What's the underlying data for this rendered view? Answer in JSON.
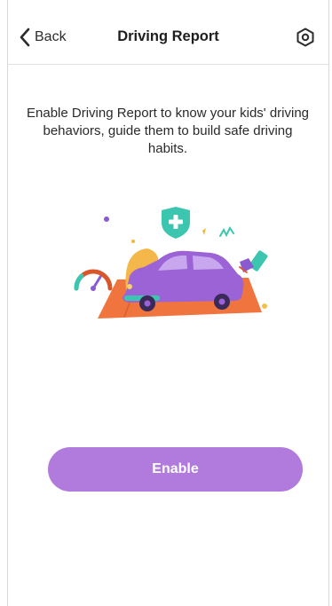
{
  "header": {
    "back_label": "Back",
    "title": "Driving Report"
  },
  "main": {
    "description": "Enable Driving Report to know your kids' driving behaviors, guide them to build safe driving habits.",
    "enable_label": "Enable"
  },
  "icons": {
    "back": "chevron-left-icon",
    "settings": "settings-gear-icon",
    "illustration": "purple-car-illustration"
  },
  "colors": {
    "accent": "#b07bdd",
    "car": "#9b63d6",
    "rug": "#f0743d",
    "shield": "#3cc6b0"
  }
}
